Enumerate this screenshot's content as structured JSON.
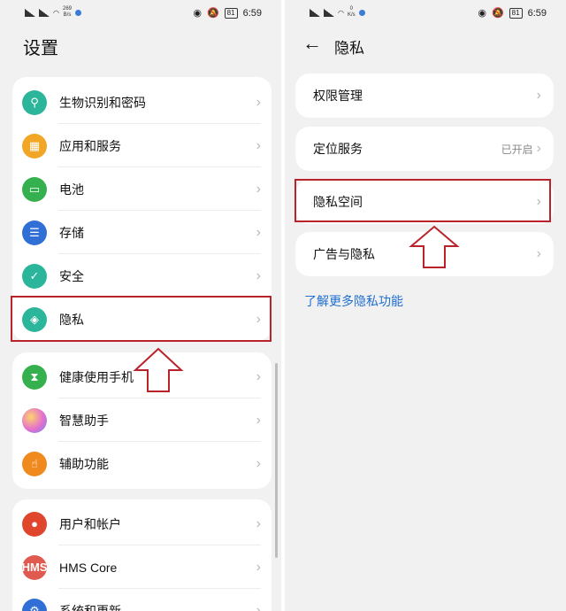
{
  "status": {
    "left_speed": "269\nB/s",
    "right_speed": "0\nK/s",
    "battery": "81",
    "time": "6:59"
  },
  "left": {
    "title": "设置",
    "group1": [
      {
        "label": "生物识别和密码",
        "icon": "key-icon",
        "color": "#2bb59a"
      },
      {
        "label": "应用和服务",
        "icon": "apps-grid-icon",
        "color": "#f1a626"
      },
      {
        "label": "电池",
        "icon": "battery-icon",
        "color": "#35b04f"
      },
      {
        "label": "存储",
        "icon": "storage-icon",
        "color": "#2f6fd6"
      },
      {
        "label": "安全",
        "icon": "shield-check-icon",
        "color": "#2bb59a"
      },
      {
        "label": "隐私",
        "icon": "privacy-shield-icon",
        "color": "#2bb59a"
      }
    ],
    "group2": [
      {
        "label": "健康使用手机",
        "icon": "hourglass-icon",
        "color": "#35b04f"
      },
      {
        "label": "智慧助手",
        "icon": "assistant-orb-icon",
        "color": "#c06bd0"
      },
      {
        "label": "辅助功能",
        "icon": "hand-icon",
        "color": "#f08a1e"
      }
    ],
    "group3": [
      {
        "label": "用户和帐户",
        "icon": "user-icon",
        "color": "#e0452d"
      },
      {
        "label": "HMS Core",
        "icon": "hms-icon",
        "color": "#e05a4f",
        "badge": "HMS"
      },
      {
        "label": "系统和更新",
        "icon": "system-update-icon",
        "color": "#2f6fd6"
      }
    ]
  },
  "right": {
    "title": "隐私",
    "items": [
      {
        "label": "权限管理",
        "value": ""
      },
      {
        "label": "定位服务",
        "value": "已开启"
      },
      {
        "label": "隐私空间",
        "value": ""
      },
      {
        "label": "广告与隐私",
        "value": ""
      }
    ],
    "link": "了解更多隐私功能"
  },
  "colors": {
    "highlight": "#b9232b",
    "link": "#1f6fd1"
  }
}
